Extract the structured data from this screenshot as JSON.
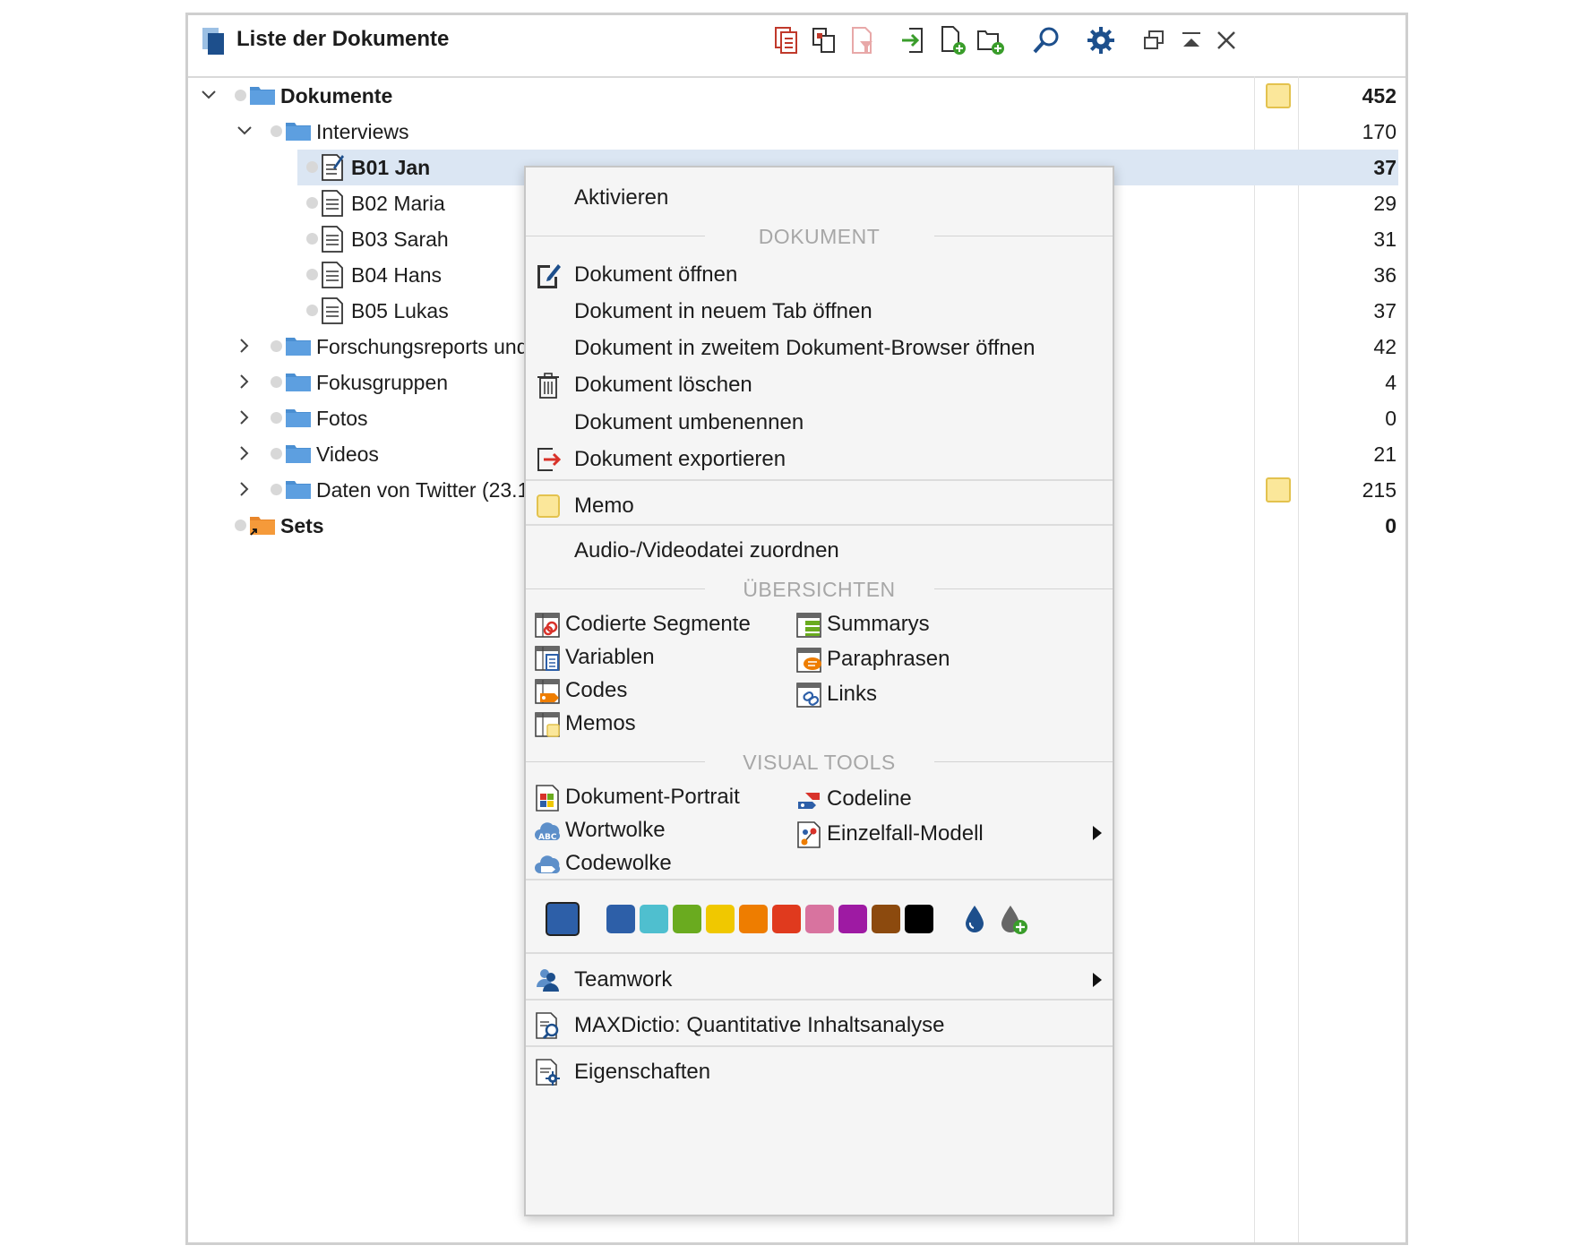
{
  "window": {
    "title": "Liste der Dokumente"
  },
  "toolbar": {
    "icons": [
      "copy-documents-icon",
      "duplicate-icon",
      "filter-document-icon",
      "import-icon",
      "new-document-icon",
      "new-document-group-icon",
      "search-icon",
      "settings-gear-icon",
      "undock-window-icon",
      "collapse-window-icon",
      "close-icon"
    ]
  },
  "tree": {
    "root": {
      "label": "Dokumente",
      "count": "452",
      "has_memo": true
    },
    "interviews": {
      "label": "Interviews",
      "count": "170"
    },
    "docs": [
      {
        "label": "B01 Jan",
        "count": "37",
        "selected": true
      },
      {
        "label": "B02 Maria",
        "count": "29"
      },
      {
        "label": "B03 Sarah",
        "count": "31"
      },
      {
        "label": "B04 Hans",
        "count": "36"
      },
      {
        "label": "B05 Lukas",
        "count": "37"
      }
    ],
    "groups": [
      {
        "label": "Forschungsreports und",
        "count": "42"
      },
      {
        "label": "Fokusgruppen",
        "count": "4"
      },
      {
        "label": "Fotos",
        "count": "0"
      },
      {
        "label": "Videos",
        "count": "21"
      },
      {
        "label": "Daten von Twitter (23.1",
        "count": "215",
        "has_memo": true
      }
    ],
    "sets": {
      "label": "Sets",
      "count": "0"
    }
  },
  "menu": {
    "activate": "Aktivieren",
    "section_document": "DOKUMENT",
    "open": "Dokument öffnen",
    "open_tab": "Dokument in neuem Tab öffnen",
    "open_second": "Dokument in zweitem Dokument-Browser öffnen",
    "delete": "Dokument löschen",
    "rename": "Dokument umbenennen",
    "export": "Dokument exportieren",
    "memo": "Memo",
    "assign_media": "Audio-/Videodatei zuordnen",
    "section_overviews": "ÜBERSICHTEN",
    "overviews_left": [
      "Codierte Segmente",
      "Variablen",
      "Codes",
      "Memos"
    ],
    "overviews_right": [
      "Summarys",
      "Paraphrasen",
      "Links"
    ],
    "section_visual": "VISUAL TOOLS",
    "visual_left": [
      "Dokument-Portrait",
      "Wortwolke",
      "Codewolke"
    ],
    "visual_right": [
      "Codeline",
      "Einzelfall-Modell"
    ],
    "colors": {
      "selected": "#2d5fa8",
      "palette": [
        "#2d5fa8",
        "#4fbfcf",
        "#6aab1f",
        "#f0c800",
        "#ee7d00",
        "#e03a1e",
        "#d8739f",
        "#9e1aa3",
        "#8c4a0e",
        "#000000"
      ]
    },
    "teamwork": "Teamwork",
    "maxdictio": "MAXDictio: Quantitative Inhaltsanalyse",
    "properties": "Eigenschaften"
  }
}
